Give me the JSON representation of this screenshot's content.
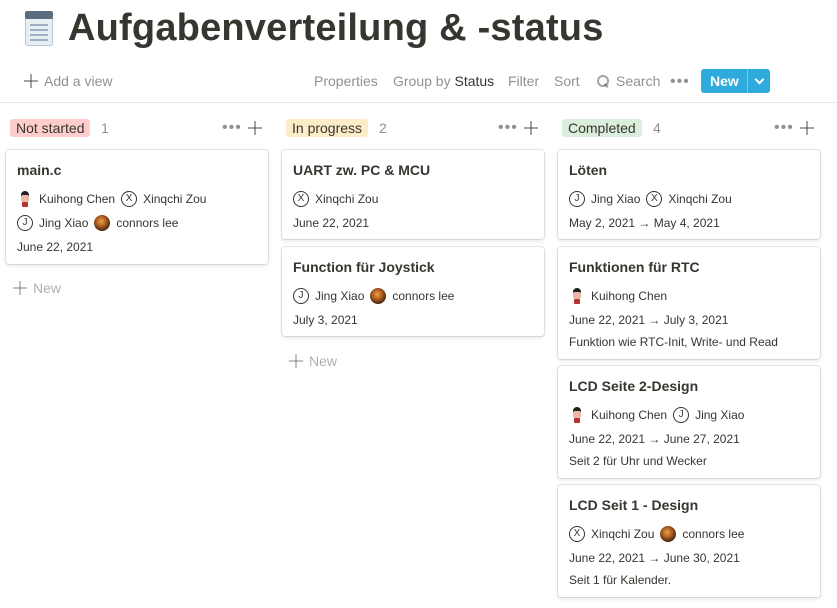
{
  "page": {
    "title": "Aufgabenverteilung & -status",
    "icon": "notepad-icon"
  },
  "toolbar": {
    "add_view": "Add a view",
    "properties": "Properties",
    "group_by_prefix": "Group by",
    "group_by_value": "Status",
    "filter": "Filter",
    "sort": "Sort",
    "search": "Search",
    "more": "•••",
    "new_label": "New",
    "accent": "#2eaadc"
  },
  "board": {
    "more": "•••",
    "new_label": "New",
    "columns": [
      {
        "name": "Not started",
        "count": "1",
        "color": "#ffcccc",
        "cards": [
          {
            "title": "main.c",
            "people": [
              [
                {
                  "initial": "",
                  "name": "Kuihong Chen",
                  "avatar": "photo-k"
                },
                {
                  "initial": "X",
                  "name": "Xinqchi Zou",
                  "avatar": "letter"
                }
              ],
              [
                {
                  "initial": "J",
                  "name": "Jing Xiao",
                  "avatar": "letter"
                },
                {
                  "initial": "",
                  "name": "connors lee",
                  "avatar": "photo-c"
                }
              ]
            ],
            "date": "June 22, 2021",
            "note": ""
          }
        ]
      },
      {
        "name": "In progress",
        "count": "2",
        "color": "#fdecc8",
        "cards": [
          {
            "title": "UART zw. PC & MCU",
            "people": [
              [
                {
                  "initial": "X",
                  "name": "Xinqchi Zou",
                  "avatar": "letter"
                }
              ]
            ],
            "date": "June 22, 2021",
            "note": ""
          },
          {
            "title": "Function für Joystick",
            "people": [
              [
                {
                  "initial": "J",
                  "name": "Jing Xiao",
                  "avatar": "letter"
                },
                {
                  "initial": "",
                  "name": "connors lee",
                  "avatar": "photo-c"
                }
              ]
            ],
            "date": "July 3, 2021",
            "note": ""
          }
        ]
      },
      {
        "name": "Completed",
        "count": "4",
        "color": "#dbeddb",
        "cards": [
          {
            "title": "Löten",
            "people": [
              [
                {
                  "initial": "J",
                  "name": "Jing Xiao",
                  "avatar": "letter"
                },
                {
                  "initial": "X",
                  "name": "Xinqchi Zou",
                  "avatar": "letter"
                }
              ]
            ],
            "date": "May 2, 2021 → May 4, 2021",
            "note": ""
          },
          {
            "title": "Funktionen für RTC",
            "people": [
              [
                {
                  "initial": "",
                  "name": "Kuihong Chen",
                  "avatar": "photo-k"
                }
              ]
            ],
            "date": "June 22, 2021 → July 3, 2021",
            "note": "Funktion wie RTC-Init, Write- und  Read"
          },
          {
            "title": "LCD Seite 2-Design",
            "people": [
              [
                {
                  "initial": "",
                  "name": "Kuihong Chen",
                  "avatar": "photo-k"
                },
                {
                  "initial": "J",
                  "name": "Jing Xiao",
                  "avatar": "letter"
                }
              ]
            ],
            "date": "June 22, 2021 → June 27, 2021",
            "note": "Seit 2 für Uhr und Wecker"
          },
          {
            "title": "LCD Seit 1 - Design",
            "people": [
              [
                {
                  "initial": "X",
                  "name": "Xinqchi Zou",
                  "avatar": "letter"
                },
                {
                  "initial": "",
                  "name": "connors lee",
                  "avatar": "photo-c"
                }
              ]
            ],
            "date": "June 22, 2021 → June 30, 2021",
            "note": "Seit 1 für Kalender."
          }
        ]
      }
    ]
  }
}
